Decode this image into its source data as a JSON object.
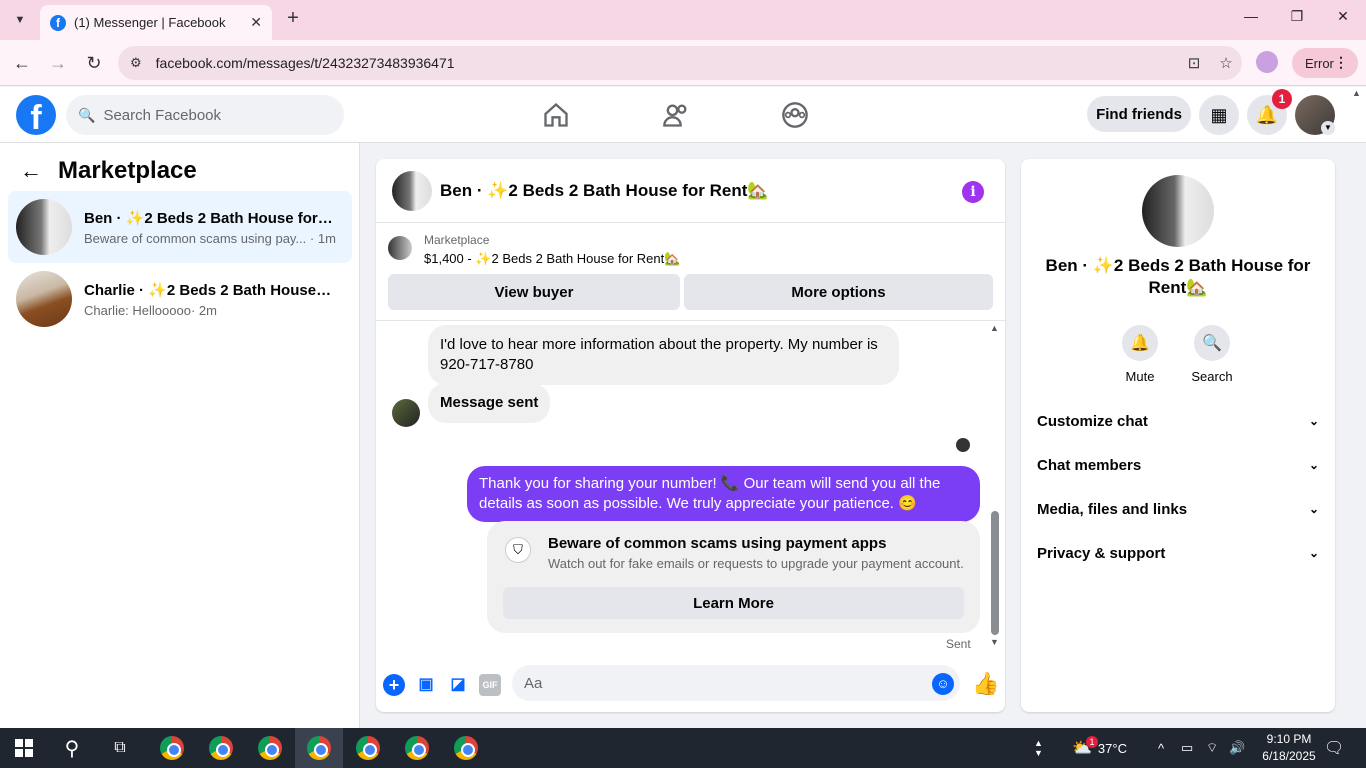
{
  "browser": {
    "tab_title": "(1) Messenger | Facebook",
    "url": "facebook.com/messages/t/24323273483936471",
    "profile_status": "Error"
  },
  "fbnav": {
    "search_placeholder": "Search Facebook",
    "find_friends": "Find friends",
    "notification_count": "1"
  },
  "sidebar": {
    "title": "Marketplace",
    "conversations": [
      {
        "name": "Ben · ✨2 Beds 2 Bath House for R...",
        "preview": "Beware of common scams using pay...",
        "time": "· 1m"
      },
      {
        "name": "Charlie · ✨2 Beds 2 Bath House fo...",
        "preview": "Charlie: Hellooooo",
        "time": "· 2m"
      }
    ]
  },
  "chat": {
    "header_name": "Ben · ✨2 Beds 2 Bath House for Rent🏡",
    "marketplace_label": "Marketplace",
    "marketplace_item": "$1,400 - ✨2 Beds 2 Bath House for Rent🏡",
    "view_buyer": "View buyer",
    "more_options": "More options",
    "messages": {
      "incoming_1": "I'd love to hear more information about the property.  My number is 920-717-8780",
      "incoming_2": "Message sent",
      "outgoing_1": "Thank you for sharing your number! 📞 Our team will send you all the details as soon as possible. We truly appreciate your patience. 😊"
    },
    "scam_card": {
      "title": "Beware of common scams using payment apps",
      "description": "Watch out for fake emails or requests to upgrade your payment account.",
      "button": "Learn More"
    },
    "sent_label": "Sent",
    "composer_placeholder": "Aa"
  },
  "details": {
    "name": "Ben · ✨2 Beds 2 Bath House for Rent🏡",
    "actions": [
      "Mute",
      "Search"
    ],
    "sections": [
      "Customize chat",
      "Chat members",
      "Media, files and links",
      "Privacy & support"
    ]
  },
  "taskbar": {
    "weather": "37°C",
    "weather_badge": "1",
    "time": "9:10 PM",
    "date": "6/18/2025"
  },
  "colors": {
    "facebook_blue": "#1877f2",
    "messenger_blue": "#0866ff",
    "outgoing_bubble": "#7b3ef5",
    "active_conversation": "#ebf5ff",
    "tab_bar": "#f7d7e6"
  }
}
